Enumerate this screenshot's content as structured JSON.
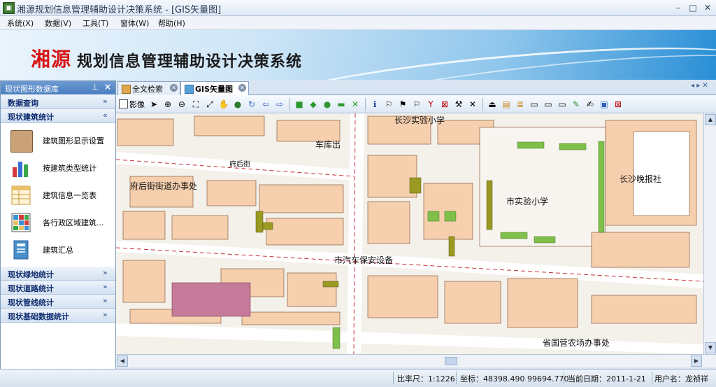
{
  "window": {
    "title": "湘源规划信息管理辅助设计决策系统 - [GIS矢量图]",
    "minimize": "–",
    "maximize": "□",
    "close": "✕"
  },
  "menu": [
    "系统(X)",
    "数据(V)",
    "工具(T)",
    "窗体(W)",
    "帮助(H)"
  ],
  "banner": {
    "brand": "湘源",
    "title": "规划信息管理辅助设计决策系统"
  },
  "left_panel": {
    "title": "现状图形数据库",
    "sections_top": [
      {
        "label": "数据查询",
        "chevron": "»"
      },
      {
        "label": "现状建筑统计",
        "chevron": "«"
      }
    ],
    "items": [
      {
        "label": "建筑图形显示设置",
        "icon": "building-display-icon",
        "color": "#c9a277"
      },
      {
        "label": "按建筑类型统计",
        "icon": "bar-chart-icon",
        "color": "#d43a3a"
      },
      {
        "label": "建筑信息一览表",
        "icon": "table-list-icon",
        "color": "#e9c06a"
      },
      {
        "label": "各行政区域建筑...",
        "icon": "region-grid-icon",
        "color": "#3a8fd6"
      },
      {
        "label": "建筑汇总",
        "icon": "summary-book-icon",
        "color": "#4a8fc9"
      }
    ],
    "sections_bottom": [
      {
        "label": "现状绿地统计",
        "chevron": "»"
      },
      {
        "label": "现状道路统计",
        "chevron": "»"
      },
      {
        "label": "现状管线统计",
        "chevron": "»"
      },
      {
        "label": "现状基础数据统计",
        "chevron": "»"
      }
    ]
  },
  "tabs": [
    {
      "label": "全文检索",
      "active": false
    },
    {
      "label": "GIS矢量图",
      "active": true
    }
  ],
  "toolbar": {
    "checkbox_label": "影像"
  },
  "map": {
    "labels": {
      "chepai": "车库出",
      "fuhou_road": "府后街",
      "fuhou_office": "府后街街道办事处",
      "changsha_school": "长沙实验小学",
      "shi_school": "市实验小学",
      "evening_news": "长沙晚报社",
      "security": "市汽车保安设备",
      "farm_office": "省国营农场办事处"
    }
  },
  "status": {
    "scale": "比率尺：1:1226",
    "coords": "坐标：48398.490  99694.770",
    "date": "当前日期：2011-1-21",
    "user": "用户名：龙祯祥"
  }
}
